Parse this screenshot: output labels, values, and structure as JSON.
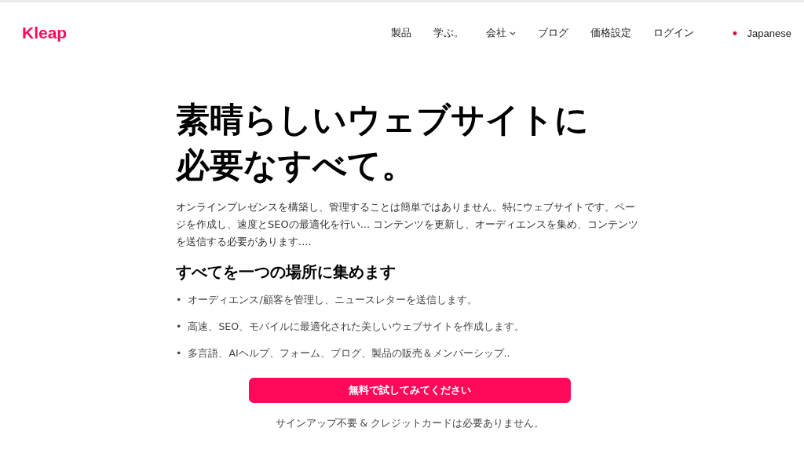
{
  "header": {
    "logo": "Kleap",
    "nav": [
      {
        "label": "製品",
        "kind": "link"
      },
      {
        "label": "学ぶ。",
        "kind": "link"
      },
      {
        "label": "会社",
        "kind": "dropdown"
      },
      {
        "label": "ブログ",
        "kind": "link"
      },
      {
        "label": "価格設定",
        "kind": "link"
      },
      {
        "label": "ログイン",
        "kind": "link"
      }
    ],
    "language": "Japanese"
  },
  "hero": {
    "title_lines": [
      "素晴らしいウェブサイトに",
      "必要なすべて。"
    ],
    "description": "オンラインプレゼンスを構築し、管理することは簡単ではありません。特にウェブサイトです。ページを作成し、速度とSEOの最適化を行い... コンテンツを更新し、オーディエンスを集め、コンテンツを送信する必要があります....",
    "subheading": "すべてを一つの場所に集めます",
    "features": [
      {
        "marker": "•",
        "text": "オーディエンス/顧客を管理し、ニュースレターを送信します。"
      },
      {
        "marker": "•",
        "text": "高速、SEO、モバイルに最適化された美しいウェブサイトを作成します。"
      },
      {
        "marker": "•",
        "text": "多言語、AIヘルプ、フォーム、ブログ、製品の販売＆メンバーシップ.."
      }
    ],
    "cta": "無料で試してみてください",
    "note": "サインアップ不要 & クレジットカードは必要ありません。"
  }
}
